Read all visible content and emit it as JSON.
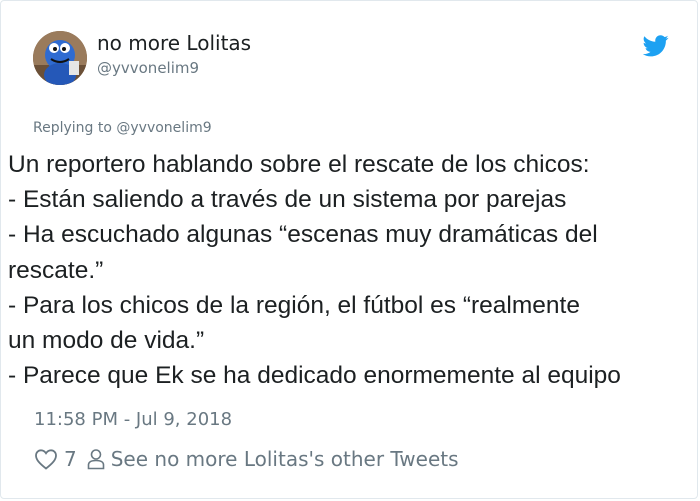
{
  "tweet": {
    "display_name": "no more Lolitas",
    "handle": "@yvvonelim9",
    "reply": {
      "prefix": "Replying to",
      "handle": "@yvvonelim9"
    },
    "body_lines": [
      "Un reportero hablando sobre el rescate de los chicos:",
      "- Están saliendo a través de un sistema por parejas",
      "- Ha escuchado algunas “escenas muy dramáticas del",
      "rescate.”",
      "- Para los chicos de la región, el fútbol es “realmente",
      "un modo de vida.”",
      "- Parece que Ek se ha dedicado enormemente al equipo"
    ],
    "timestamp": "11:58 PM - Jul 9, 2018",
    "like_count": "7",
    "other_tweets_label": "See no more Lolitas's other Tweets"
  },
  "colors": {
    "twitter_blue": "#1da1f2",
    "text": "#1c2022",
    "muted": "#697882",
    "border": "#e1e8ed"
  },
  "icons": {
    "brand": "twitter-bird-icon",
    "like": "heart-icon",
    "profile": "user-icon"
  }
}
